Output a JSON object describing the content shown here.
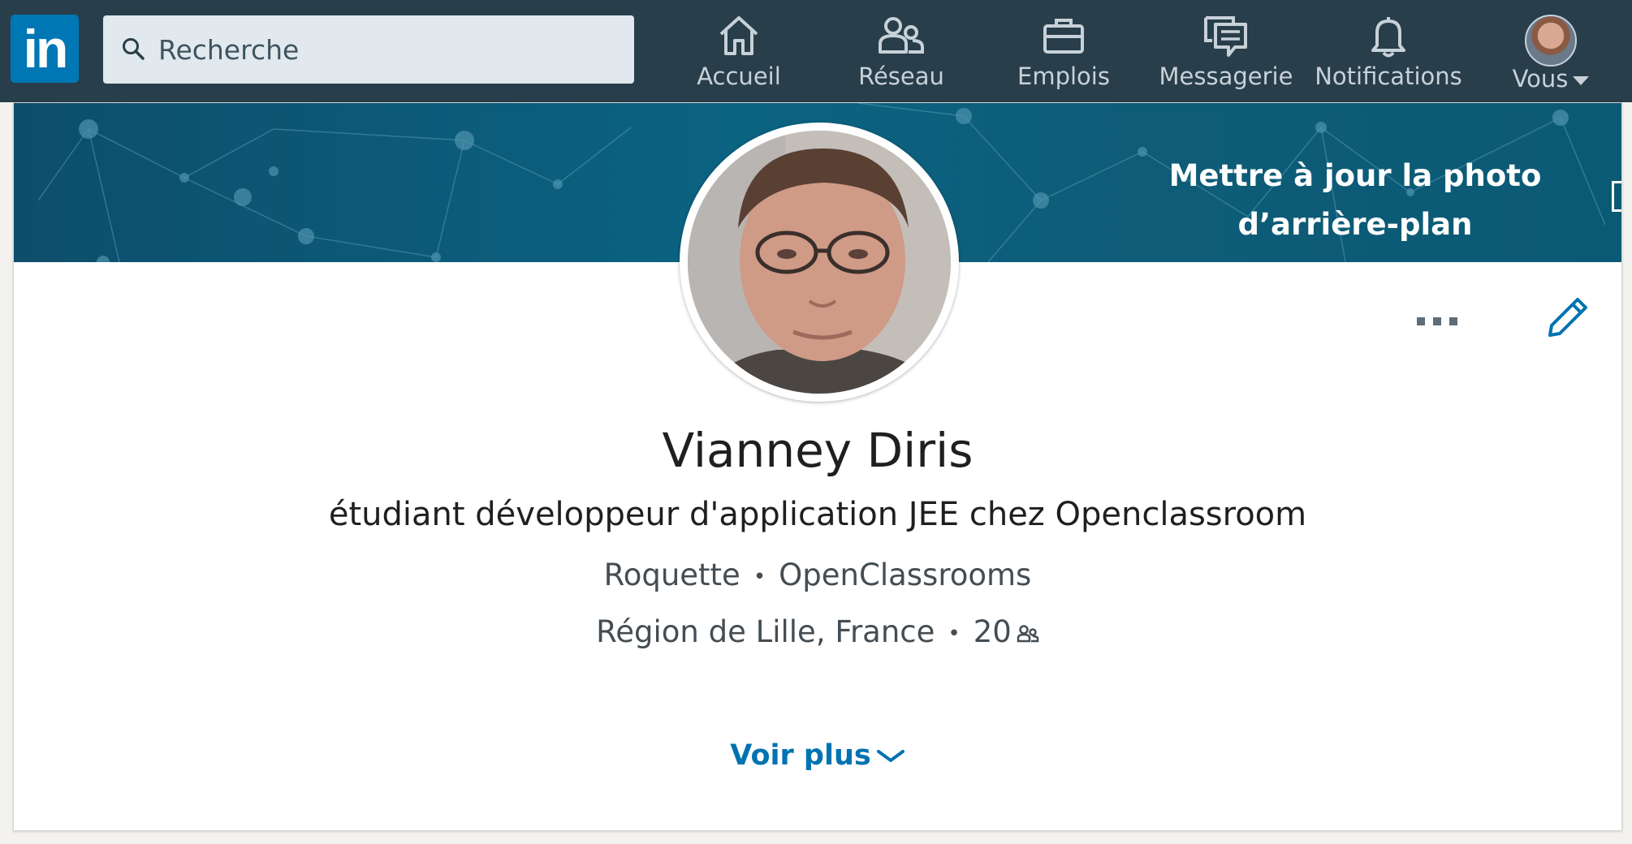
{
  "nav": {
    "logo_text": "in",
    "search": {
      "placeholder": "Recherche"
    },
    "items": [
      {
        "label": "Accueil",
        "icon": "home-icon"
      },
      {
        "label": "Réseau",
        "icon": "network-icon"
      },
      {
        "label": "Emplois",
        "icon": "briefcase-icon"
      },
      {
        "label": "Messagerie",
        "icon": "messaging-icon"
      },
      {
        "label": "Notifications",
        "icon": "bell-icon"
      },
      {
        "label": "Vous",
        "icon": "avatar"
      }
    ]
  },
  "profile": {
    "banner_cta": "Mettre à jour la photo d’arrière-plan",
    "name": "Vianney Diris",
    "headline": "étudiant développeur d'application JEE chez Openclassroom",
    "company": "Roquette",
    "school": "OpenClassrooms",
    "location": "Région de Lille, France",
    "connections": "20",
    "show_more": "Voir plus"
  },
  "colors": {
    "nav_bg": "#283e4a",
    "brand": "#0077b5",
    "link": "#0073b1",
    "banner": "#0b6382"
  }
}
